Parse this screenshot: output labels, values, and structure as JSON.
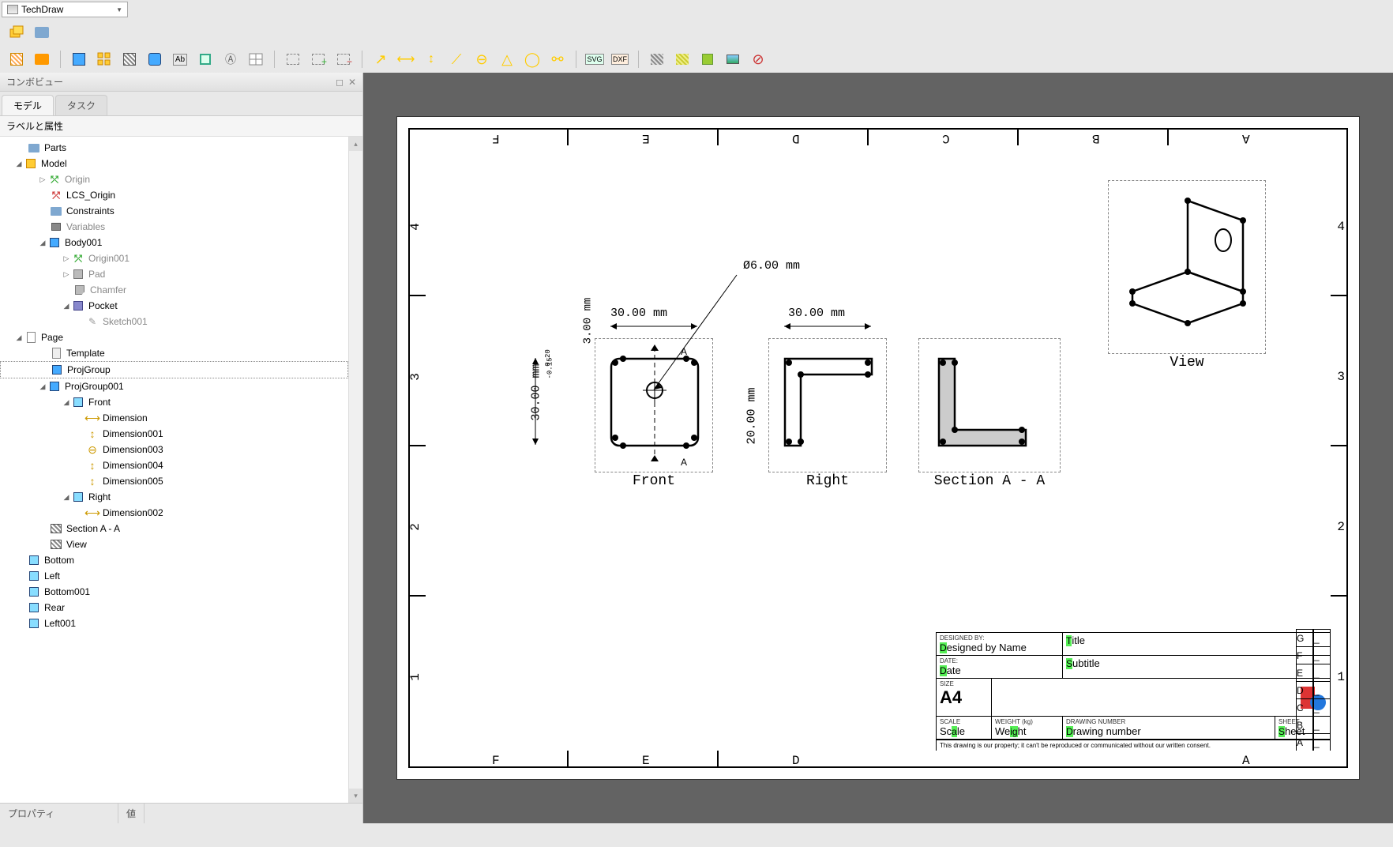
{
  "app": {
    "workbench_dropdown": "TechDraw"
  },
  "sidepanel": {
    "title": "コンボビュー",
    "tabs": {
      "model": "モデル",
      "task": "タスク"
    },
    "labels_header": "ラベルと属性",
    "prop_header": {
      "property": "プロパティ",
      "value": "値"
    }
  },
  "tree": {
    "parts": "Parts",
    "model": "Model",
    "origin": "Origin",
    "lcs_origin": "LCS_Origin",
    "constraints": "Constraints",
    "variables": "Variables",
    "body001": "Body001",
    "origin001": "Origin001",
    "pad": "Pad",
    "chamfer": "Chamfer",
    "pocket": "Pocket",
    "sketch001": "Sketch001",
    "page": "Page",
    "template": "Template",
    "projgroup": "ProjGroup",
    "projgroup001": "ProjGroup001",
    "front": "Front",
    "dimension": "Dimension",
    "dimension001": "Dimension001",
    "dimension003": "Dimension003",
    "dimension004": "Dimension004",
    "dimension005": "Dimension005",
    "right": "Right",
    "dimension002": "Dimension002",
    "section_aa": "Section A - A",
    "view": "View",
    "bottom": "Bottom",
    "left": "Left",
    "bottom001": "Bottom001",
    "rear": "Rear",
    "left001": "Left001"
  },
  "drawing": {
    "columns_top": [
      "F",
      "E",
      "D",
      "C",
      "B",
      "A"
    ],
    "columns_bottom": [
      "F",
      "E",
      "D",
      "A"
    ],
    "rows": [
      "4",
      "3",
      "2",
      "1"
    ],
    "views": {
      "front": "Front",
      "right": "Right",
      "section": "Section A - A",
      "view": "View"
    },
    "dims": {
      "dia": "Ø6.00 mm",
      "w30_1": "30.00 mm",
      "w30_2": "30.00 mm",
      "h30": "30.00 mm",
      "h3": "3.00 mm",
      "h20": "20.00 mm",
      "tol_up": "0.20",
      "tol_dn": "-0.15",
      "sec_a1": "A",
      "sec_a2": "A"
    },
    "titleblock": {
      "designed_by_lbl": "DESIGNED BY:",
      "designed_by": "Designed by Name",
      "date_lbl": "DATE:",
      "date": "Date",
      "size_lbl": "SIZE",
      "size": "A4",
      "title_lbl": "Title",
      "subtitle_lbl": "Subtitle",
      "scale_lbl": "SCALE",
      "scale": "Scale",
      "weight_lbl": "WEIGHT (kg)",
      "weight": "Weight",
      "drawing_no_lbl": "DRAWING NUMBER",
      "drawing_no": "Drawing number",
      "sheet_lbl": "SHEET",
      "sheet": "Sheet",
      "disclaimer": "This drawing is our property; it can't be reproduced or communicated without our written consent.",
      "revisions": [
        "G",
        "F",
        "E",
        "D",
        "C",
        "B",
        "A"
      ],
      "rev_dash": "_"
    }
  }
}
